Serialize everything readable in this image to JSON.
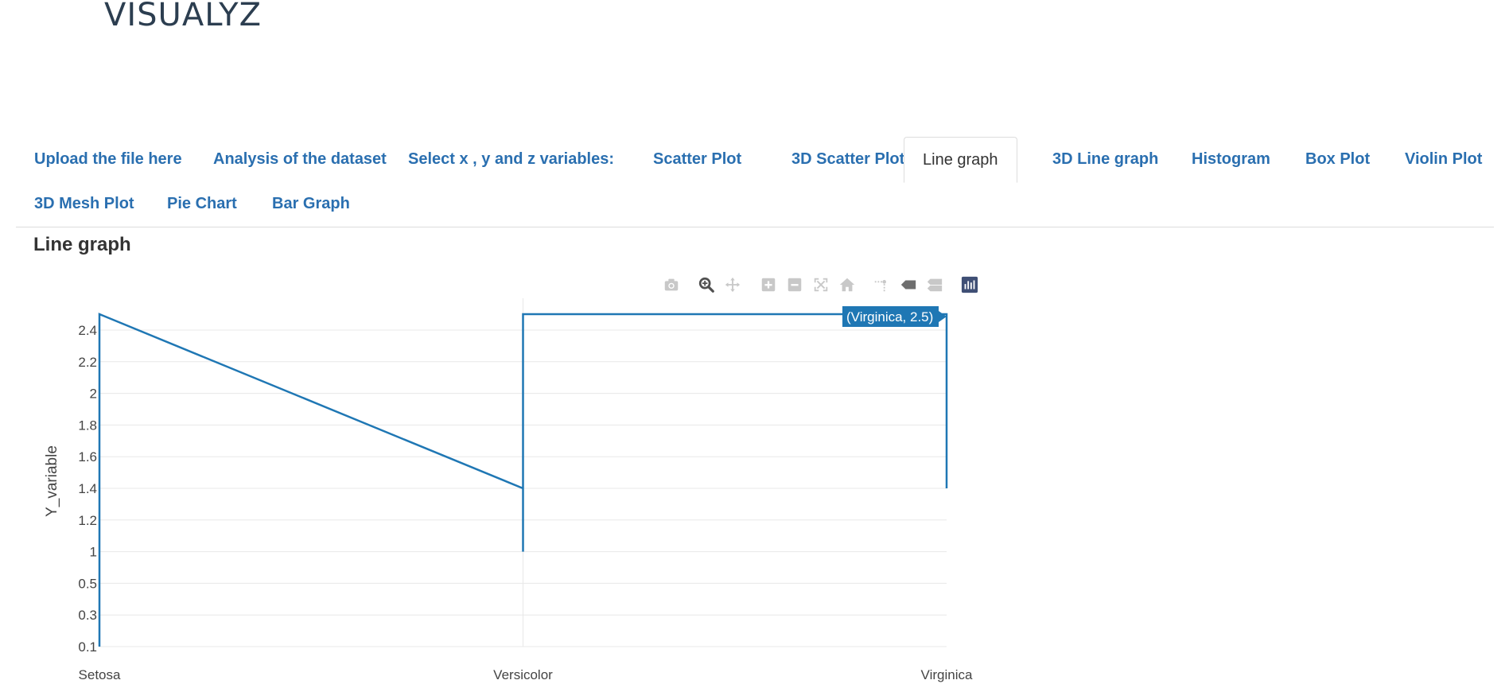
{
  "app": {
    "title": "VISUALYZ"
  },
  "tabs": [
    {
      "label": "Upload the file here",
      "active": false
    },
    {
      "label": "Analysis of the dataset",
      "active": false
    },
    {
      "label": "Select x , y and z variables:",
      "active": false
    },
    {
      "label": "Scatter Plot",
      "active": false
    },
    {
      "label": "3D Scatter Plot",
      "active": false
    },
    {
      "label": "Line graph",
      "active": true
    },
    {
      "label": "3D Line graph",
      "active": false
    },
    {
      "label": "Histogram",
      "active": false
    },
    {
      "label": "Box Plot",
      "active": false
    },
    {
      "label": "Violin Plot",
      "active": false
    },
    {
      "label": "3D Mesh Plot",
      "active": false
    },
    {
      "label": "Pie Chart",
      "active": false
    },
    {
      "label": "Bar Graph",
      "active": false
    }
  ],
  "section": {
    "title": "Line graph"
  },
  "modebar": {
    "icons": [
      "camera-icon",
      "zoom-icon",
      "pan-icon",
      "zoom-in-icon",
      "zoom-out-icon",
      "autoscale-icon",
      "reset-axes-icon",
      "spike-lines-icon",
      "hover-closest-icon",
      "hover-compare-icon",
      "plotly-logo-icon"
    ]
  },
  "chart_data": {
    "type": "line",
    "categories": [
      "Setosa",
      "Versicolor",
      "Virginica"
    ],
    "y_ticks": [
      "0.1",
      "0.3",
      "0.5",
      "1",
      "1.2",
      "1.4",
      "1.6",
      "1.8",
      "2",
      "2.2",
      "2.4"
    ],
    "ylabel": "Y_variable",
    "xlabel": "",
    "series": [
      {
        "points": [
          {
            "x": "Setosa",
            "y": "0.5"
          },
          {
            "x": "Setosa",
            "y": "0.1"
          },
          {
            "x": "Setosa",
            "y": "0.2"
          },
          {
            "x": "Versicolor",
            "y": "1.4"
          },
          {
            "x": "Versicolor",
            "y": "1.8"
          },
          {
            "x": "Versicolor",
            "y": "1"
          },
          {
            "x": "Versicolor",
            "y": "1.3"
          },
          {
            "x": "Virginica",
            "y": "2.5"
          },
          {
            "x": "Virginica",
            "y": "1.4"
          }
        ],
        "color": "#1f77b4"
      }
    ],
    "hover_label": "(Virginica, 2.5)",
    "grid": true
  }
}
